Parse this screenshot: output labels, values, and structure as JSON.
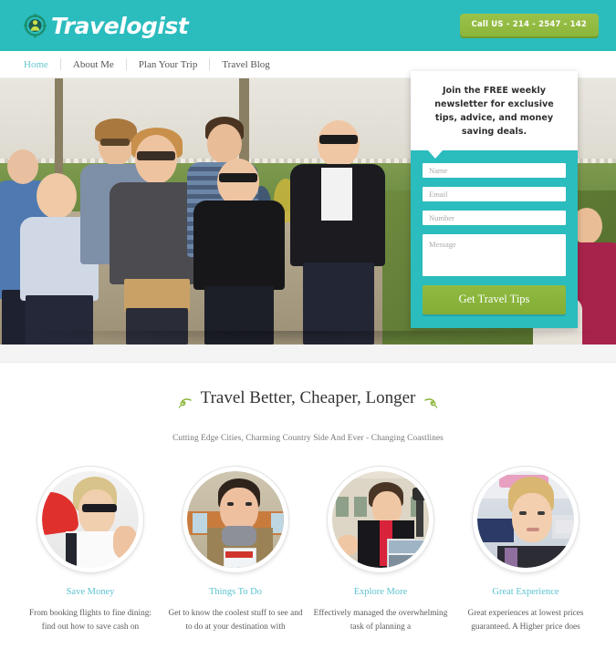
{
  "brand": {
    "name": "Travelogist",
    "logo_icon": "person-target-icon",
    "accent_teal": "#2bbcbe",
    "accent_green": "#8cb53c",
    "link_blue": "#64c8d2"
  },
  "header": {
    "call_button_label": "Call US - 214 - 2547 - 142"
  },
  "nav": {
    "items": [
      {
        "label": "Home",
        "active": true
      },
      {
        "label": "About Me",
        "active": false
      },
      {
        "label": "Plan Your Trip",
        "active": false
      },
      {
        "label": "Travel Blog",
        "active": false
      }
    ]
  },
  "newsletter": {
    "headline": "Join the FREE weekly newsletter for exclusive tips, advice, and money saving deals.",
    "fields": {
      "name_placeholder": "Name",
      "email_placeholder": "Email",
      "number_placeholder": "Number",
      "message_placeholder": "Message"
    },
    "submit_label": "Get Travel Tips"
  },
  "hero": {
    "alt": "Group of young travelers walking in a park"
  },
  "section": {
    "heading": "Travel Better, Cheaper, Longer",
    "ornament_icon": "leaf-swirl-icon",
    "subheading": "Cutting Edge Cities, Charming Country Side And Ever - Changing Coastlines"
  },
  "features": [
    {
      "title": "Save Money",
      "text": "From booking flights to fine dining: find out how to save cash on",
      "image_alt": "Woman in sunglasses and white polo shirt"
    },
    {
      "title": "Things To Do",
      "text": "Get to know the coolest stuff to see and to do at your destination with",
      "image_alt": "Man holding a Belfast guidebook"
    },
    {
      "title": "Explore More",
      "text": "Effectively managed the overwhelming task of planning a",
      "image_alt": "Tour guide with red scarf holding photo board"
    },
    {
      "title": "Great Experience",
      "text": "Great experiences at lowest prices guaranteed. A Higher price does",
      "image_alt": "Blonde woman smiling in a shop"
    }
  ]
}
